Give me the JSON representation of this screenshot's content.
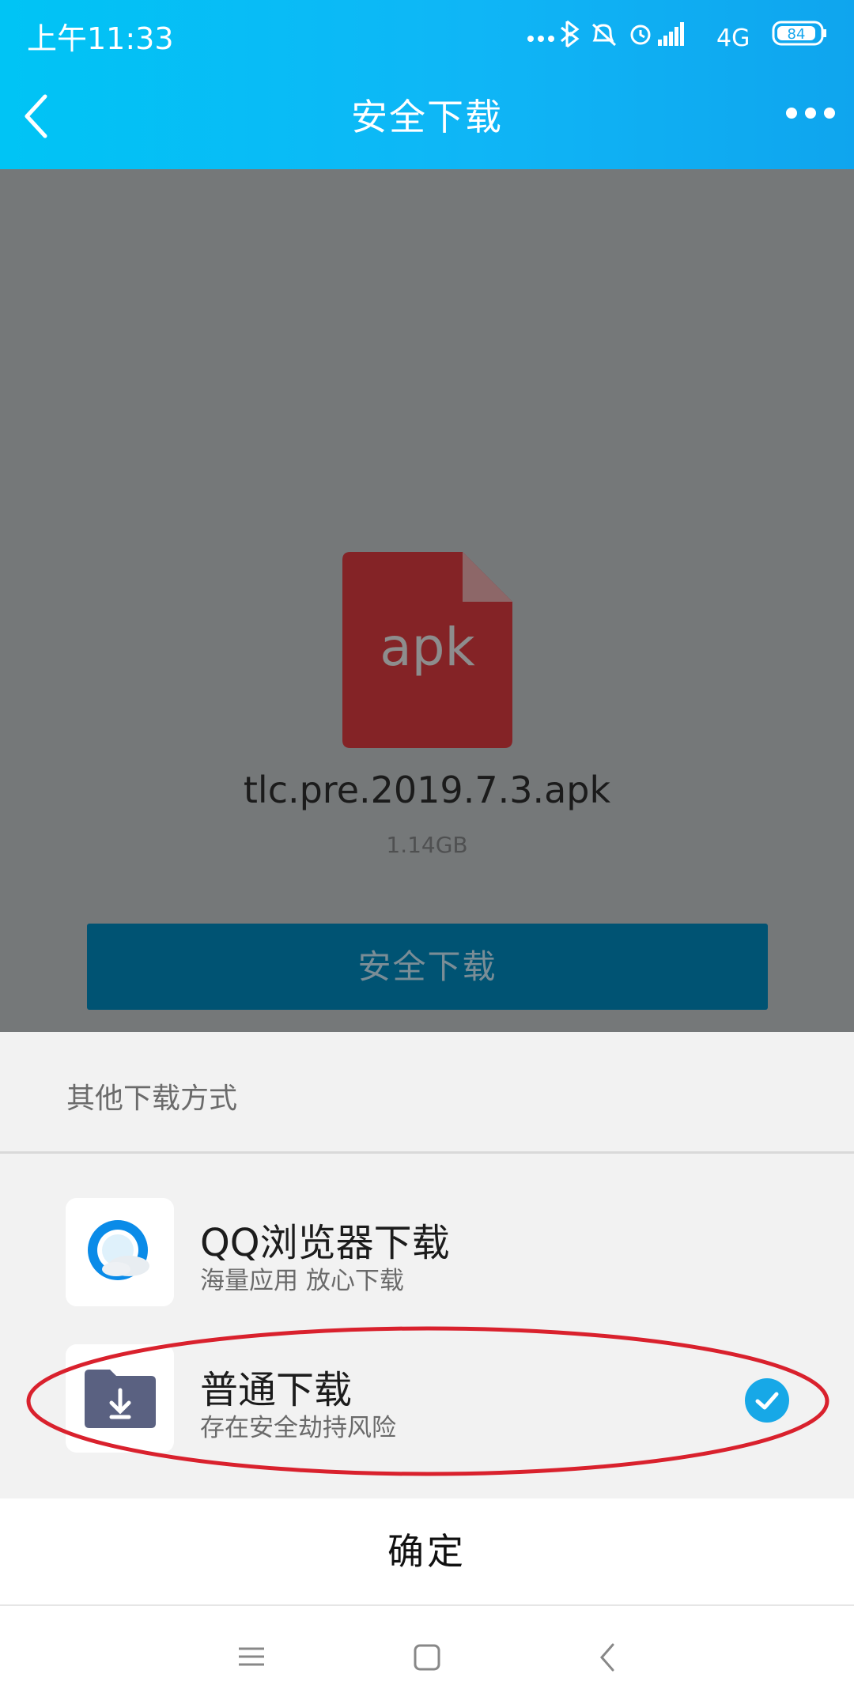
{
  "status_bar": {
    "time": "上午11:33",
    "network": "4G",
    "battery": "84"
  },
  "header": {
    "title": "安全下载"
  },
  "file": {
    "type_label": "apk",
    "name": "tlc.pre.2019.7.3.apk",
    "size": "1.14GB"
  },
  "download_button": {
    "label": "安全下载"
  },
  "sheet": {
    "title": "其他下载方式",
    "options": [
      {
        "title": "QQ浏览器下载",
        "subtitle": "海量应用 放心下载",
        "selected": false
      },
      {
        "title": "普通下载",
        "subtitle": "存在安全劫持风险",
        "selected": true
      }
    ],
    "confirm_label": "确定"
  },
  "colors": {
    "header": "#0fb6f6",
    "dim_overlay": "#757879",
    "apk_icon": "#842326",
    "download_button": "#005373",
    "check": "#17a8e7",
    "annotation_ellipse": "#d9212d"
  },
  "icons": [
    "back-icon",
    "more-icon",
    "apk-file-icon",
    "qq-browser-icon",
    "folder-download-icon",
    "check-icon",
    "menu-icon",
    "home-icon",
    "back-nav-icon"
  ]
}
